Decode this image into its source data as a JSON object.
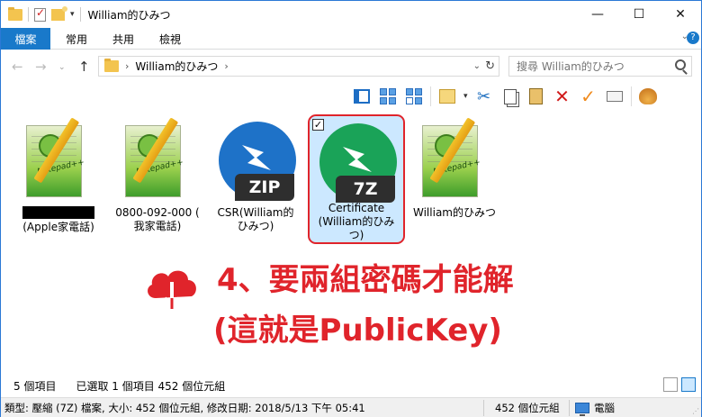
{
  "window": {
    "title": "William的ひみつ",
    "controls": {
      "minimize": "—",
      "maximize": "☐",
      "close": "✕"
    }
  },
  "ribbon": {
    "tabs": [
      {
        "label": "檔案",
        "active": true
      },
      {
        "label": "常用"
      },
      {
        "label": "共用"
      },
      {
        "label": "檢視"
      }
    ],
    "expand_glyph": "⌄",
    "help_glyph": "?"
  },
  "navigation": {
    "back_glyph": "←",
    "forward_glyph": "→",
    "recent_glyph": "⌄",
    "up_glyph": "↑",
    "breadcrumb": [
      "William的ひみつ"
    ],
    "crumb_separator": "›",
    "refresh_glyph": "↻",
    "search_placeholder": "搜尋 William的ひみつ"
  },
  "toolbar": {
    "icons": [
      "preview-pane-icon",
      "large-icons-view-icon",
      "medium-icons-view-icon",
      "select-all-icon",
      "cut-icon",
      "copy-icon",
      "paste-icon",
      "delete-icon",
      "rename-icon",
      "properties-icon",
      "shell-icon"
    ],
    "cut_glyph": "✂",
    "delete_glyph": "✕",
    "rename_glyph": "✓",
    "drop_glyph": "▾"
  },
  "files": [
    {
      "name_line1": "",
      "name_line2": "(Apple家電話)",
      "icon": "notepad-plus-plus-icon",
      "redacted": true,
      "selected": false
    },
    {
      "name_line1": "0800-092-000 (",
      "name_line2": "我家電話)",
      "icon": "notepad-plus-plus-icon",
      "selected": false
    },
    {
      "name_line1": "CSR(William的",
      "name_line2": "ひみつ)",
      "icon": "zip-archive-icon",
      "tag": "ZIP",
      "color": "#1e72c8",
      "selected": false
    },
    {
      "name_line1": "Certificate",
      "name_line2": "(William的ひみ",
      "name_line3": "つ)",
      "icon": "7z-archive-icon",
      "tag": "7Z",
      "color": "#1aa358",
      "selected": true
    },
    {
      "name_line1": "William的ひみつ",
      "name_line2": "",
      "icon": "notepad-plus-plus-icon",
      "selected": false
    }
  ],
  "notepad_icon_text": "Notepad++",
  "annotation": {
    "line1": "4、要兩組密碼才能解",
    "line2": "(這就是PublicKey)",
    "color": "#e0242b"
  },
  "status": {
    "item_count": "5 個項目",
    "selection": "已選取 1 個項目  452 個位元組"
  },
  "details": {
    "info": "類型: 壓縮 (7Z) 檔案, 大小: 452 個位元組, 修改日期: 2018/5/13 下午 05:41",
    "size": "452 個位元組",
    "location": "電腦"
  },
  "colors": {
    "accent": "#1979ca",
    "selection_fill": "#cce8ff",
    "highlight_border": "#e0242b"
  }
}
